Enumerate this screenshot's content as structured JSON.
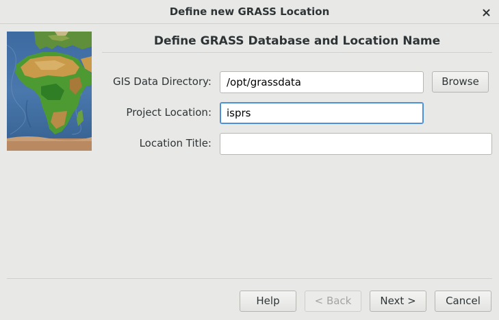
{
  "window": {
    "title": "Define new GRASS Location",
    "close_icon": "close-icon"
  },
  "sidebar_image": {
    "icon": "world-map-image"
  },
  "page": {
    "heading": "Define GRASS Database and Location Name"
  },
  "form": {
    "gis_data_directory": {
      "label": "GIS Data Directory:",
      "value": "/opt/grassdata",
      "browse_label": "Browse"
    },
    "project_location": {
      "label": "Project Location:",
      "value": "isprs"
    },
    "location_title": {
      "label": "Location Title:",
      "value": ""
    }
  },
  "footer": {
    "help_label": "Help",
    "back_label": "< Back",
    "next_label": "Next >",
    "cancel_label": "Cancel"
  },
  "colors": {
    "background": "#e8e8e7",
    "focus_accent": "#4a90d9",
    "text": "#2e3436",
    "disabled_text": "#a3a5a3"
  }
}
